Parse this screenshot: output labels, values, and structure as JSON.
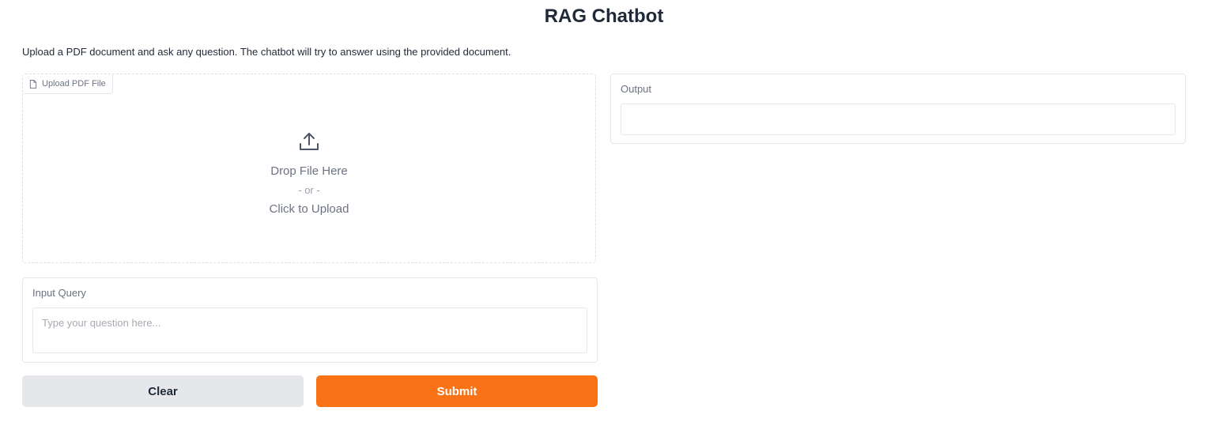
{
  "header": {
    "title": "RAG Chatbot",
    "description": "Upload a PDF document and ask any question. The chatbot will try to answer using the provided document."
  },
  "upload": {
    "label": "Upload PDF File",
    "label_icon": "file-icon",
    "icon": "upload-icon",
    "drop_text": "Drop File Here",
    "or_text": "- or -",
    "click_text": "Click to Upload"
  },
  "query": {
    "label": "Input Query",
    "value": "",
    "placeholder": "Type your question here..."
  },
  "buttons": {
    "clear_label": "Clear",
    "submit_label": "Submit"
  },
  "output": {
    "label": "Output",
    "value": ""
  },
  "colors": {
    "accent": "#f97316",
    "secondary_button": "#e5e7eb",
    "border": "#e5e7eb",
    "muted_text": "#6b7280"
  }
}
